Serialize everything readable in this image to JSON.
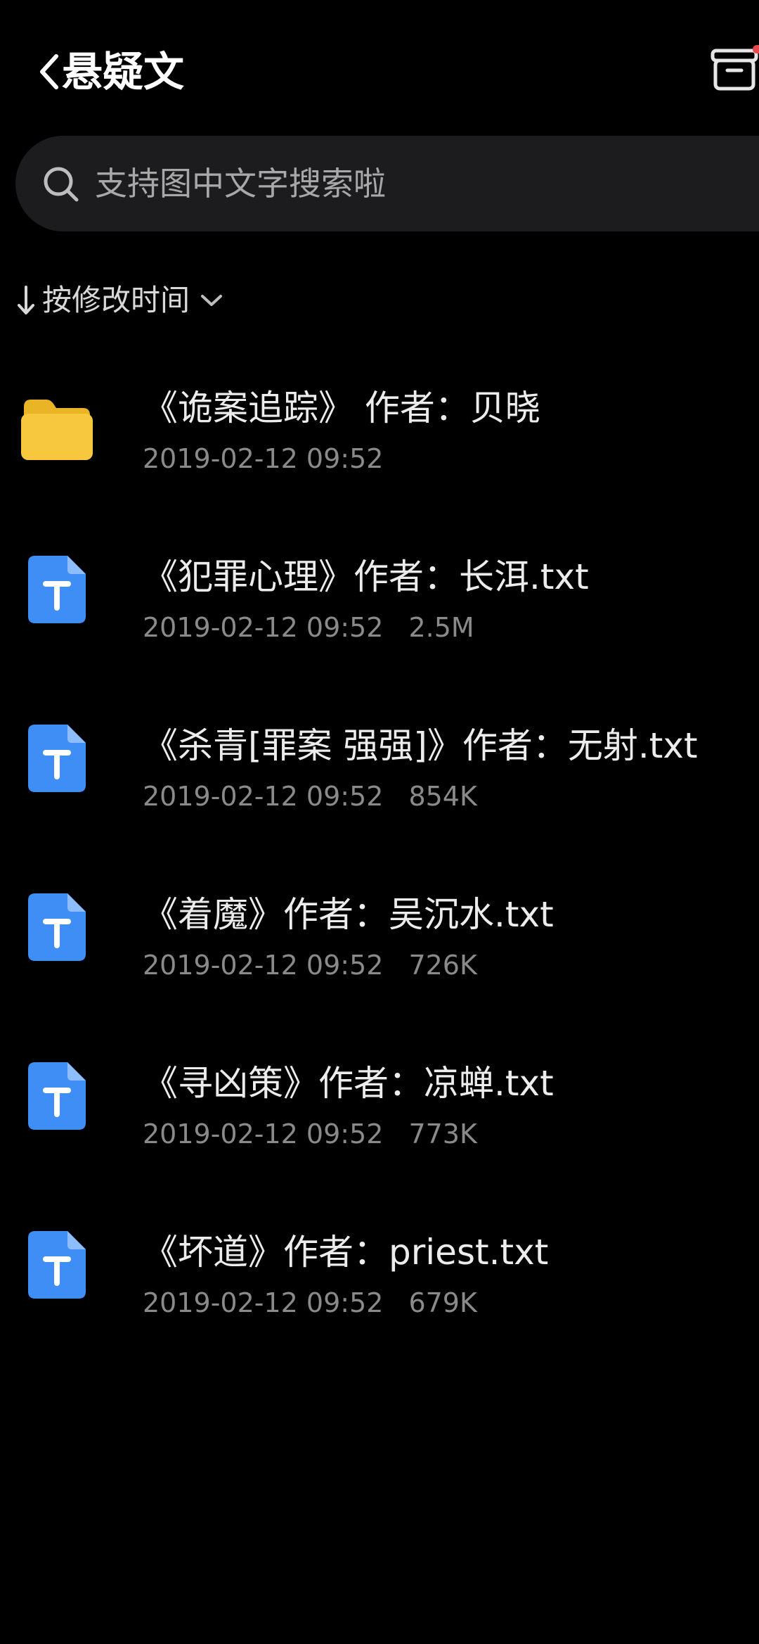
{
  "header": {
    "title": "悬疑文"
  },
  "search": {
    "placeholder": "支持图中文字搜索啦"
  },
  "sort": {
    "label": "按修改时间"
  },
  "files": [
    {
      "type": "folder",
      "name": "《诡案追踪》 作者：贝晓",
      "date": "2019-02-12 09:52",
      "size": ""
    },
    {
      "type": "txt",
      "name": "《犯罪心理》作者：长洱.txt",
      "date": "2019-02-12 09:52",
      "size": "2.5M"
    },
    {
      "type": "txt",
      "name": "《杀青[罪案 强强]》作者：无射.txt",
      "date": "2019-02-12 09:52",
      "size": "854K"
    },
    {
      "type": "txt",
      "name": "《着魔》作者：吴沉水.txt",
      "date": "2019-02-12 09:52",
      "size": "726K"
    },
    {
      "type": "txt",
      "name": "《寻凶策》作者：凉蝉.txt",
      "date": "2019-02-12 09:52",
      "size": "773K"
    },
    {
      "type": "txt",
      "name": "《坏道》作者：priest.txt",
      "date": "2019-02-12 09:52",
      "size": "679K"
    }
  ],
  "colors": {
    "background": "#000000",
    "search_bg": "#1c1c1e",
    "folder": "#f7c73d",
    "txt_icon": "#3f8ef6",
    "badge": "#e64a4a"
  }
}
